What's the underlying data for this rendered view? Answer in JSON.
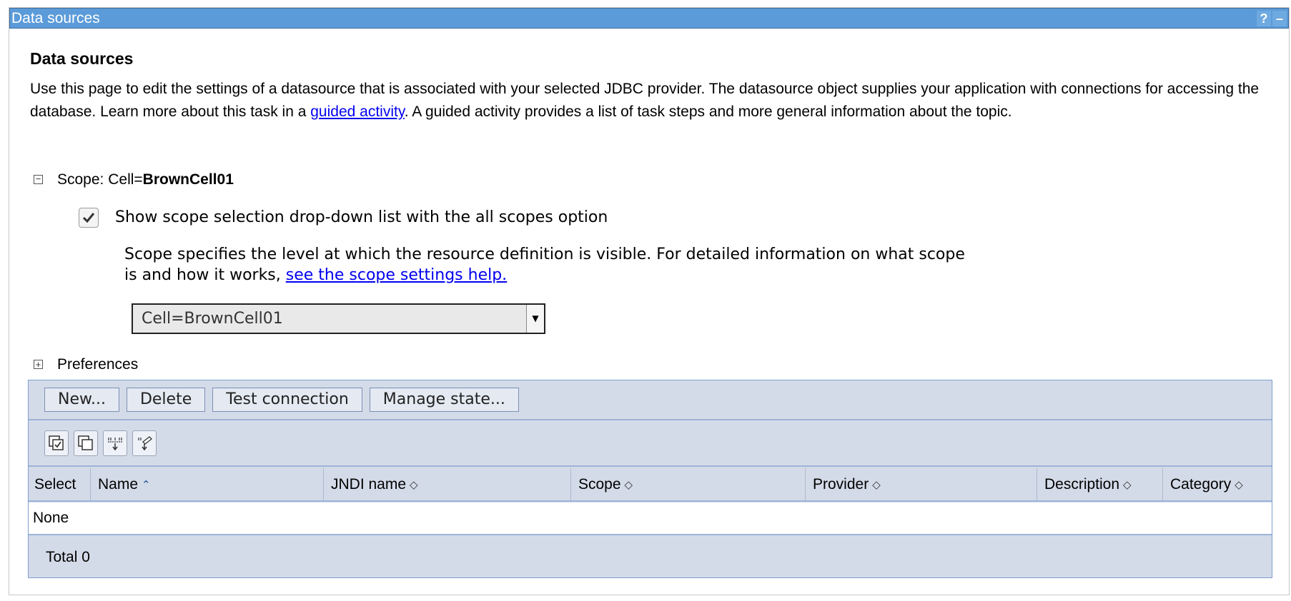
{
  "window": {
    "title": "Data sources",
    "help_icon": "?",
    "minimize_icon": "–"
  },
  "page": {
    "heading": "Data sources",
    "description_part1": "Use this page to edit the settings of a datasource that is associated with your selected JDBC provider. The datasource object supplies your application with connections for accessing the database. Learn more about this task in a ",
    "description_link": "guided activity",
    "description_part2": ". A guided activity provides a list of task steps and more general information about the topic."
  },
  "scope": {
    "label": "Scope: ",
    "value_prefix": "Cell=",
    "value_bold": "BrownCell01",
    "checkbox_label": "Show scope selection drop-down list with the all scopes option",
    "checkbox_checked": true,
    "help_text": "Scope specifies the level at which the resource definition is visible. For detailed information on what scope is and how it works, ",
    "help_link": "see the scope settings help.",
    "selected_option": "Cell=BrownCell01"
  },
  "preferences": {
    "label": "Preferences"
  },
  "toolbar": {
    "new_label": "New...",
    "delete_label": "Delete",
    "test_label": "Test connection",
    "manage_label": "Manage state..."
  },
  "icons": {
    "select_all": "select-all-icon",
    "deselect_all": "deselect-all-icon",
    "show_filter": "show-filter-icon",
    "clear_filter": "clear-filter-icon"
  },
  "table": {
    "columns": [
      "Select",
      "Name",
      "JNDI name",
      "Scope",
      "Provider",
      "Description",
      "Category"
    ],
    "empty_text": "None",
    "total": "Total 0"
  },
  "colors": {
    "titlebar": "#5b9bd9",
    "table_bg": "#d4dbe8",
    "link": "#0000ee"
  }
}
